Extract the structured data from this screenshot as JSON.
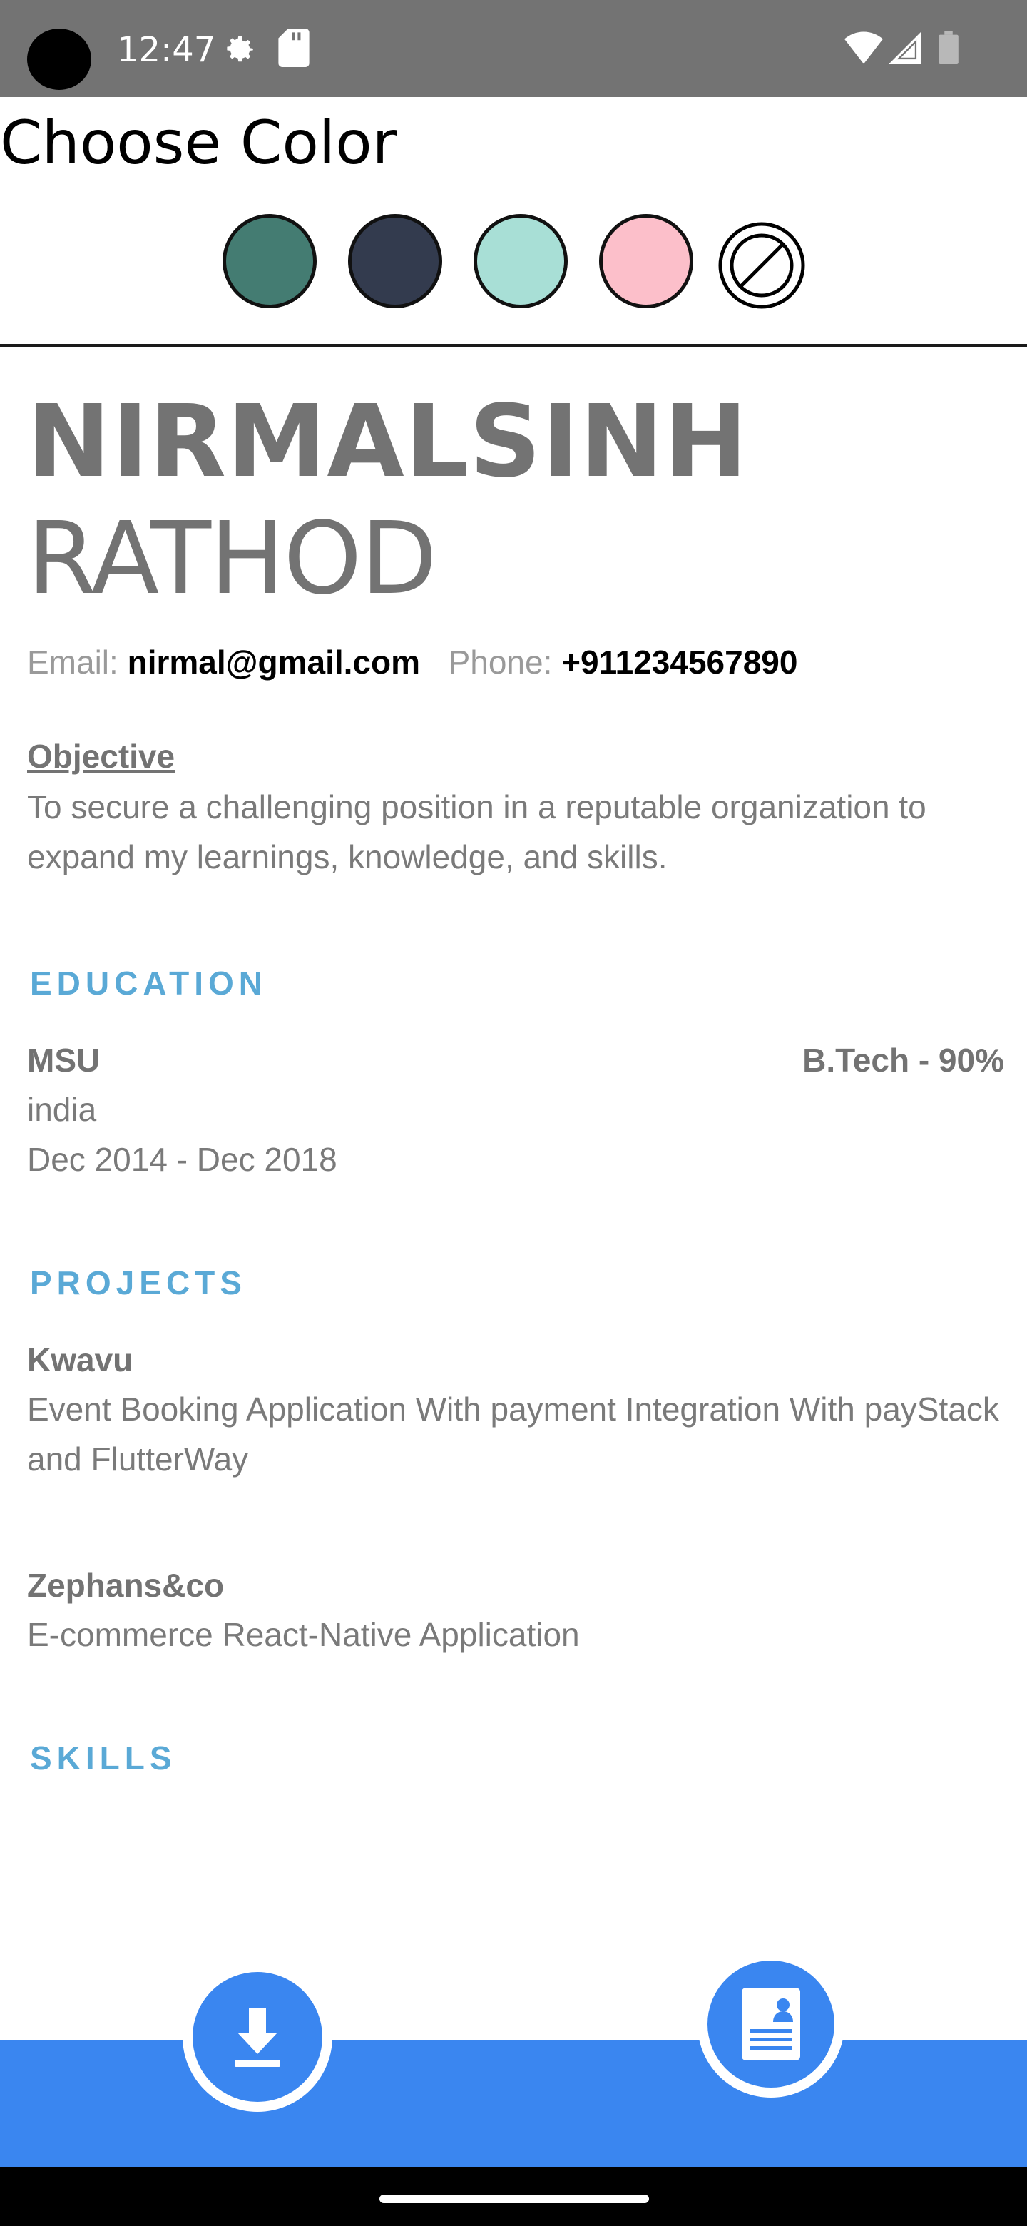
{
  "status_bar": {
    "time": "12:47",
    "icons": [
      "settings-icon",
      "sd-card-icon",
      "wifi-icon",
      "signal-icon",
      "battery-icon"
    ]
  },
  "page": {
    "title": "Choose Color"
  },
  "color_picker": {
    "swatches": [
      {
        "name": "teal",
        "color": "#447c72"
      },
      {
        "name": "navy",
        "color": "#333b4e"
      },
      {
        "name": "mint",
        "color": "#a8dfd6"
      },
      {
        "name": "pink",
        "color": "#fcbfca"
      }
    ],
    "none_option_icon": "no-color-icon"
  },
  "resume": {
    "first_name": "NIRMALSINH",
    "last_name": "RATHOD",
    "email_label": "Email:",
    "email": "nirmal@gmail.com",
    "phone_label": "Phone:",
    "phone": "+911234567890",
    "objective_title": "Objective",
    "objective_text": "To secure a challenging position in a reputable organization to expand my learnings, knowledge, and skills.",
    "education": {
      "heading": "EDUCATION",
      "school": "MSU",
      "degree": "B.Tech - 90%",
      "location": "india",
      "dates": "Dec 2014 - Dec 2018"
    },
    "projects": {
      "heading": "PROJECTS",
      "items": [
        {
          "name": "Kwavu",
          "description": "Event Booking Application With payment Integration With payStack and FlutterWay"
        },
        {
          "name": "Zephans&co",
          "description": "E-commerce React-Native Application"
        }
      ]
    },
    "skills": {
      "heading": "SKILLS"
    }
  },
  "bottom_bar": {
    "download_icon": "download-icon",
    "resume_icon": "resume-document-icon",
    "accent_color": "#3a86f0"
  }
}
